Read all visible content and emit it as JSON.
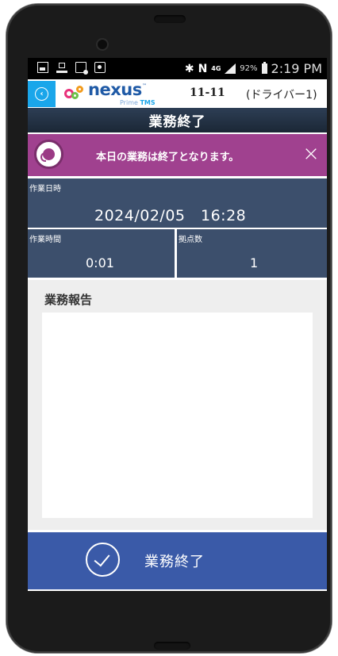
{
  "status_bar": {
    "network": "4G",
    "battery": "92%",
    "time": "2:19 PM"
  },
  "header": {
    "logo_text": "nexus",
    "logo_tm": "™",
    "logo_sub_prefix": "Prime",
    "logo_sub_brand": "TMS",
    "vehicle_code": "11-11",
    "driver": "(ドライバー1)"
  },
  "title": "業務終了",
  "notice": {
    "message": "本日の業務は終了となります。"
  },
  "work_date": {
    "label": "作業日時",
    "value": "2024/02/05　16:28"
  },
  "work_time": {
    "label": "作業時間",
    "value": "0:01"
  },
  "sites": {
    "label": "拠点数",
    "value": "1"
  },
  "report": {
    "label": "業務報告",
    "value": ""
  },
  "finish_button": {
    "label": "業務終了"
  },
  "colors": {
    "accent_blue": "#1aa6ea",
    "notice_purple": "#a0418f",
    "info_navy": "#3c4f6c",
    "button_blue": "#3a5aa8"
  }
}
